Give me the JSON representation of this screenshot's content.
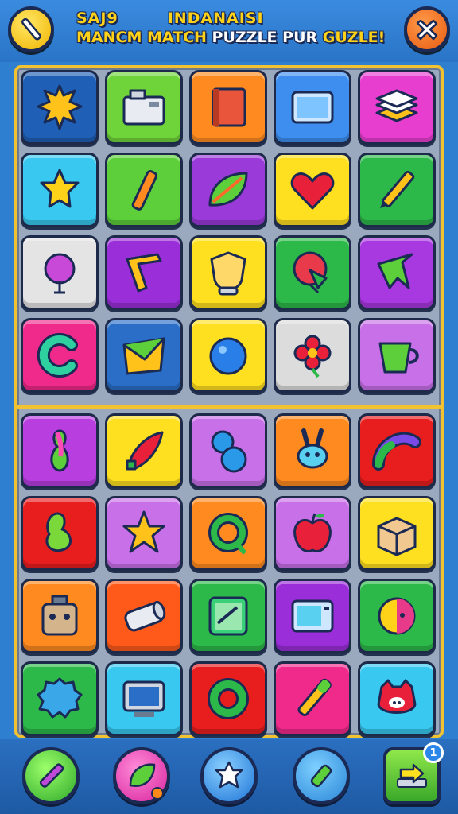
{
  "header": {
    "title_line1_left": "SAJ9",
    "title_line1_right": "INDANAISI",
    "title_line2_a": "MANCM ",
    "title_line2_b": "MATCH ",
    "title_line2_c": "PUZZLE PUR ",
    "title_line2_d": "GUZLE!"
  },
  "board": {
    "top_tiles": [
      {
        "icon": "sun-burst-icon",
        "bg": "#1f5fb5"
      },
      {
        "icon": "toaster-icon",
        "bg": "#6fd43a"
      },
      {
        "icon": "book-icon",
        "bg": "#ff8a20"
      },
      {
        "icon": "tablet-icon",
        "bg": "#3e8ef0"
      },
      {
        "icon": "stack-icon",
        "bg": "#e83ed0"
      },
      {
        "icon": "star-shape-icon",
        "bg": "#38c8f0"
      },
      {
        "icon": "crayon-icon",
        "bg": "#5ccf3a"
      },
      {
        "icon": "leaf-icon",
        "bg": "#9a3ad8"
      },
      {
        "icon": "heart-icon",
        "bg": "#ffe020"
      },
      {
        "icon": "pencil-icon",
        "bg": "#2db84a"
      },
      {
        "icon": "tree-icon",
        "bg": "#e4e4e4"
      },
      {
        "icon": "boomerang-icon",
        "bg": "#9a2ed8"
      },
      {
        "icon": "shield-icon",
        "bg": "#ffe020"
      },
      {
        "icon": "balloon-icon",
        "bg": "#2db84a"
      },
      {
        "icon": "arrow-leaf-icon",
        "bg": "#a838e0"
      },
      {
        "icon": "letter-c-icon",
        "bg": "#f02a8a"
      },
      {
        "icon": "envelope-icon",
        "bg": "#2a6ec8"
      },
      {
        "icon": "ball-icon",
        "bg": "#ffe020"
      },
      {
        "icon": "flower-icon",
        "bg": "#dcdcdc"
      },
      {
        "icon": "cup-icon",
        "bg": "#c870e8"
      }
    ],
    "bottom_tiles": [
      {
        "icon": "bowling-pin-icon",
        "bg": "#b83ee0"
      },
      {
        "icon": "chili-icon",
        "bg": "#ffe020"
      },
      {
        "icon": "peanut-icon",
        "bg": "#c870e8"
      },
      {
        "icon": "bunny-icon",
        "bg": "#ff8a20"
      },
      {
        "icon": "worm-icon",
        "bg": "#e81e1e"
      },
      {
        "icon": "blob-icon",
        "bg": "#e81e1e"
      },
      {
        "icon": "starfish-icon",
        "bg": "#c870e8"
      },
      {
        "icon": "ring-icon",
        "bg": "#ff8a20"
      },
      {
        "icon": "apple-icon",
        "bg": "#c870e8"
      },
      {
        "icon": "box-icon",
        "bg": "#ffe020"
      },
      {
        "icon": "robot-icon",
        "bg": "#ff8a20"
      },
      {
        "icon": "can-icon",
        "bg": "#ff5a1a"
      },
      {
        "icon": "board-game-icon",
        "bg": "#2db84a"
      },
      {
        "icon": "microwave-icon",
        "bg": "#9a2ed8"
      },
      {
        "icon": "beach-ball-icon",
        "bg": "#2db84a"
      },
      {
        "icon": "cloud-blob-icon",
        "bg": "#2db84a"
      },
      {
        "icon": "monitor-icon",
        "bg": "#38c8f0"
      },
      {
        "icon": "wreath-icon",
        "bg": "#e81e1e"
      },
      {
        "icon": "marker-icon",
        "bg": "#f02a8a"
      },
      {
        "icon": "pig-icon",
        "bg": "#38c8f0"
      }
    ]
  },
  "bottom_bar": {
    "powerups": [
      "crayon-icon",
      "leaf-icon",
      "star-blob-icon",
      "bottle-icon"
    ],
    "next_badge": "1"
  }
}
